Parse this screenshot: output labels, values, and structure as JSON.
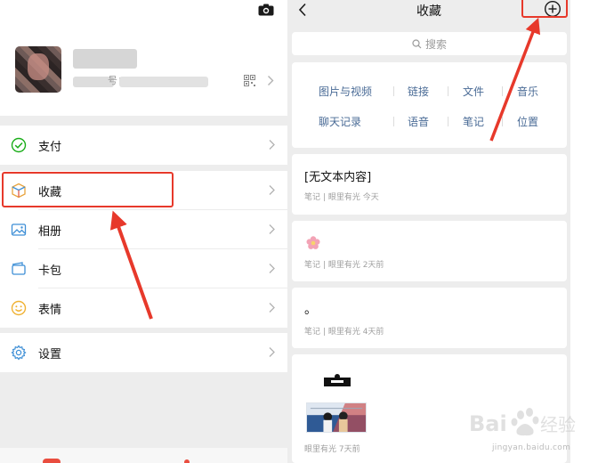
{
  "profile": {
    "id_separator": "号：",
    "icons": [
      "camera-icon",
      "qr-code-icon",
      "chevron-right-icon"
    ]
  },
  "menu": {
    "group1": [
      {
        "label": "支付",
        "icon": "pay-check-icon"
      }
    ],
    "group2": [
      {
        "label": "收藏",
        "icon": "favorites-cube-icon"
      },
      {
        "label": "相册",
        "icon": "photo-album-icon"
      },
      {
        "label": "卡包",
        "icon": "card-wallet-icon"
      },
      {
        "label": "表情",
        "icon": "emoji-face-icon"
      }
    ],
    "group3": [
      {
        "label": "设置",
        "icon": "gear-icon"
      }
    ]
  },
  "favorites": {
    "title": "收藏",
    "search_placeholder": "搜索",
    "categories_row1": [
      "图片与视频",
      "链接",
      "文件",
      "音乐"
    ],
    "categories_row2": [
      "聊天记录",
      "语音",
      "笔记",
      "位置"
    ],
    "items": [
      {
        "title": "[无文本内容]",
        "type": "笔记",
        "source": "眼里有光",
        "time": "今天"
      },
      {
        "title": "",
        "type": "笔记",
        "source": "眼里有光",
        "time": "2天前"
      },
      {
        "title": "。",
        "type": "笔记",
        "source": "眼里有光",
        "time": "4天前"
      },
      {
        "title": "",
        "type": "",
        "source": "眼里有光",
        "time": "7天前"
      }
    ],
    "meta_separator": "|"
  },
  "watermark": {
    "brand": "Bai du 经验",
    "url": "jingyan.baidu.com"
  },
  "colors": {
    "accent_red": "#e7392b",
    "link_blue": "#4a6b96",
    "pay_green": "#1aad19",
    "background_gray": "#ededed"
  }
}
